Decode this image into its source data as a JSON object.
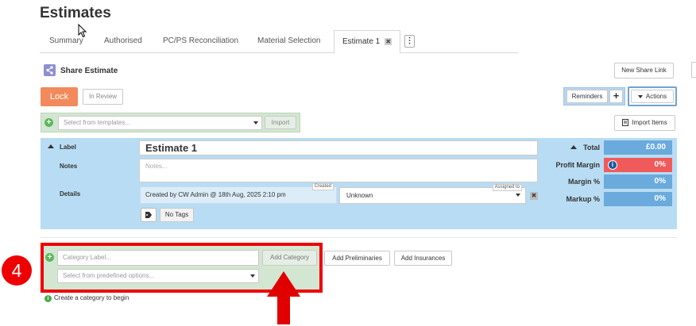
{
  "page": {
    "title": "Estimates"
  },
  "tabs": [
    {
      "label": "Summary"
    },
    {
      "label": "Authorised"
    },
    {
      "label": "PC/PS Reconciliation"
    },
    {
      "label": "Material Selection"
    },
    {
      "label": "Estimate 1",
      "active": true
    }
  ],
  "tab_close_glyph": "✖",
  "kebab_glyph": "⋮",
  "share": {
    "label": "Share Estimate",
    "new_link_label": "New Share Link"
  },
  "toolbar": {
    "lock_label": "Lock",
    "in_review_label": "In Review",
    "reminders_label": "Reminders",
    "add_glyph": "+",
    "actions_label": "Actions",
    "import_items_label": "Import Items"
  },
  "templates": {
    "placeholder": "Select from templates...",
    "import_label": "Import"
  },
  "estimate": {
    "label_heading": "Label",
    "name": "Estimate 1",
    "notes_heading": "Notes",
    "notes_placeholder": "Notes...",
    "details_heading": "Details",
    "created_text": "Created by  CW Admin @ 18th Aug, 2025 2:10 pm",
    "created_tag": "Created",
    "assigned_tag": "Assigned to",
    "assigned_value": "Unknown",
    "no_tags_label": "No Tags"
  },
  "totals": [
    {
      "label": "Total",
      "value": "£0.00",
      "color": "#6aaadd"
    },
    {
      "label": "Profit Margin",
      "value": "0%",
      "color": "#f05a5a"
    },
    {
      "label": "Margin %",
      "value": "0%",
      "color": "#6aaadd"
    },
    {
      "label": "Markup %",
      "value": "0%",
      "color": "#6aaadd"
    }
  ],
  "category": {
    "label_placeholder": "Category Label...",
    "add_label": "Add Category",
    "predefined_placeholder": "Select from predefined options...",
    "add_preliminaries_label": "Add Preliminaries",
    "add_insurances_label": "Add Insurances",
    "hint": "Create a category to begin"
  },
  "annotation": {
    "step": "4",
    "color": "#e00000"
  },
  "colors": {
    "accent": "#f28a5c",
    "panel": "#b8dcf3",
    "green": "#d3e6d1"
  }
}
